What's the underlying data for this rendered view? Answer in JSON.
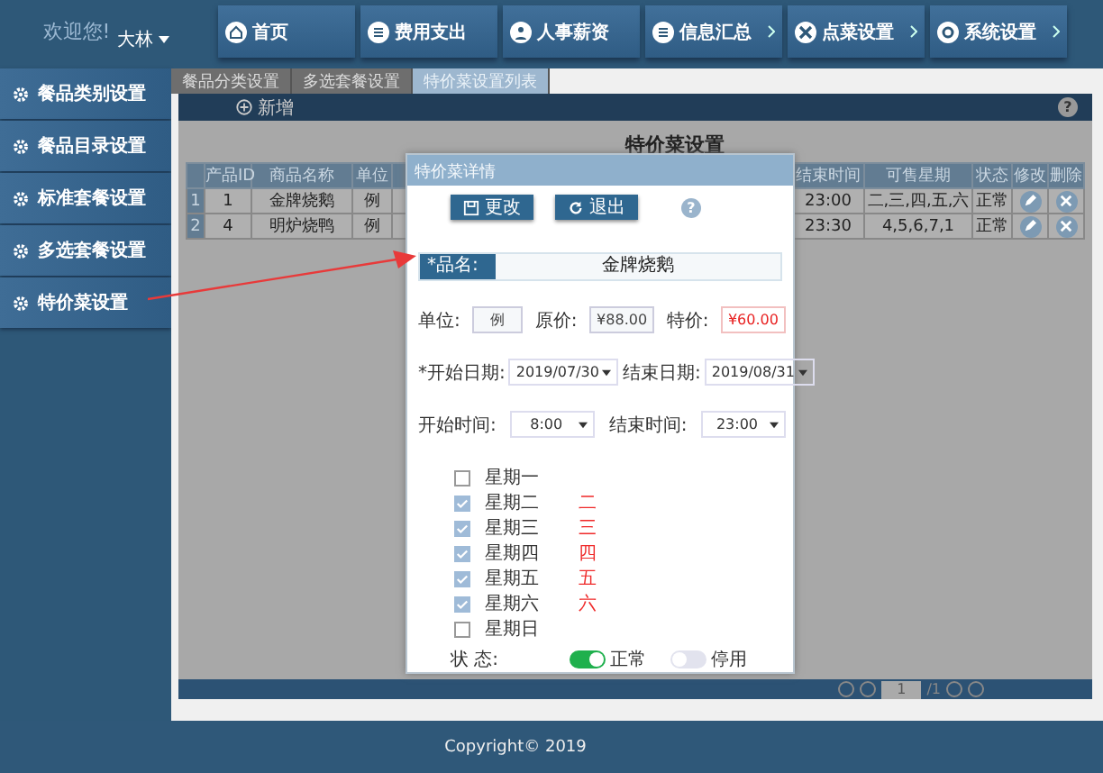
{
  "header": {
    "welcome": "欢迎您!",
    "user": "大林"
  },
  "nav": [
    {
      "label": "首页",
      "arrow": false
    },
    {
      "label": "费用支出",
      "arrow": false
    },
    {
      "label": "人事薪资",
      "arrow": false
    },
    {
      "label": "信息汇总",
      "arrow": true
    },
    {
      "label": "点菜设置",
      "arrow": true
    },
    {
      "label": "系统设置",
      "arrow": true
    }
  ],
  "sidebar": {
    "items": [
      "餐品类别设置",
      "餐品目录设置",
      "标准套餐设置",
      "多选套餐设置",
      "特价菜设置"
    ]
  },
  "tabs": [
    {
      "label": "餐品分类设置",
      "selected": false
    },
    {
      "label": "多选套餐设置",
      "selected": false
    },
    {
      "label": "特价菜设置列表",
      "selected": true
    }
  ],
  "toolbar": {
    "add": "新增",
    "help": "?"
  },
  "page_title": "特价菜设置",
  "table": {
    "columns": [
      "产品ID",
      "商品名称",
      "单位",
      "结束时间",
      "可售星期",
      "状态",
      "修改",
      "删除"
    ],
    "rows": [
      {
        "index": "1",
        "cells": [
          "1",
          "金牌烧鹅",
          "例",
          "23:00",
          "二,三,四,五,六",
          "正常"
        ]
      },
      {
        "index": "2",
        "cells": [
          "4",
          "明炉烧鸭",
          "例",
          "23:30",
          "4,5,6,7,1",
          "正常"
        ]
      }
    ]
  },
  "pagination": {
    "page": "1",
    "total": "/1"
  },
  "dialog": {
    "title": "特价菜详情",
    "buttons": [
      "更改",
      "退出"
    ],
    "help": "?",
    "name_label": "*品名:",
    "name": "金牌烧鹅",
    "prices": [
      {
        "label": "单位:",
        "value": "例",
        "red": false
      },
      {
        "label": "原价:",
        "value": "¥88.00",
        "red": false
      },
      {
        "label": "特价:",
        "value": "¥60.00",
        "red": true
      }
    ],
    "dates": [
      {
        "label": "*开始日期:",
        "value": "2019/07/30"
      },
      {
        "label": "结束日期:",
        "value": "2019/08/31"
      }
    ],
    "times": [
      {
        "label": "开始时间:",
        "value": "8:00"
      },
      {
        "label": "结束时间:",
        "value": "23:00"
      }
    ],
    "days": [
      {
        "label": "星期一",
        "checked": false
      },
      {
        "label": "星期二",
        "checked": true,
        "mark": "二"
      },
      {
        "label": "星期三",
        "checked": true,
        "mark": "三"
      },
      {
        "label": "星期四",
        "checked": true,
        "mark": "四"
      },
      {
        "label": "星期五",
        "checked": true,
        "mark": "五"
      },
      {
        "label": "星期六",
        "checked": true,
        "mark": "六"
      },
      {
        "label": "星期日",
        "checked": false
      }
    ],
    "status_label": "状 态:",
    "status": [
      {
        "label": "正常",
        "on": true
      },
      {
        "label": "停用",
        "on": false
      }
    ]
  },
  "footer": "Copyright© 2019"
}
